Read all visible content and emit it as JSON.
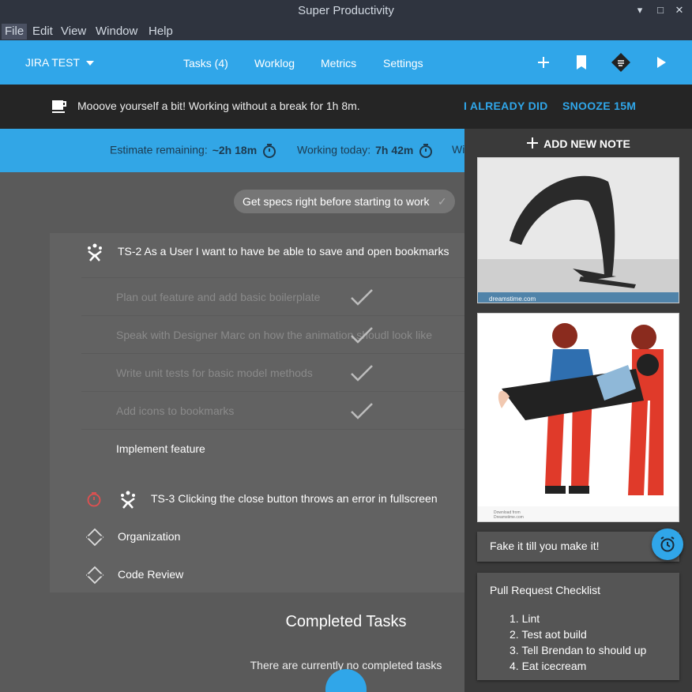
{
  "window": {
    "title": "Super Productivity",
    "minimize": "▾",
    "maximize": "□",
    "close": "✕"
  },
  "menu": [
    "File",
    "Edit",
    "View",
    "Window",
    "Help"
  ],
  "header": {
    "project": "JIRA TEST",
    "nav": [
      "Tasks (4)",
      "Worklog",
      "Metrics",
      "Settings"
    ]
  },
  "banner": {
    "message": "Mooove yourself a bit! Working without a break for 1h 8m.",
    "btn_done": "I ALREADY DID",
    "btn_snooze": "SNOOZE 15M"
  },
  "stats": {
    "estimate_label": "Estimate remaining:",
    "estimate_value": "~2h 18m",
    "working_label": "Working today:",
    "working_value": "7h 42m",
    "overflow": "Wi"
  },
  "focus_chip": "Get specs right before starting to work",
  "tasks": [
    {
      "id": "ts2",
      "label": "TS-2 As a User I want to have be able to save and open bookmarks",
      "icon": "jira-icon"
    },
    {
      "id": "ts3",
      "label": "TS-3 Clicking the close button throws an error in fullscreen",
      "icon": "jira-icon"
    },
    {
      "id": "org",
      "label": "Organization",
      "icon": "repeat-icon"
    },
    {
      "id": "review",
      "label": "Code Review",
      "icon": "repeat-icon"
    }
  ],
  "subtasks": [
    {
      "label": "Plan out feature and add basic boilerplate",
      "done": true
    },
    {
      "label": "Speak with Designer Marc on how the animation shoudl look like",
      "done": true
    },
    {
      "label": "Write unit tests for basic model methods",
      "done": true
    },
    {
      "label": "Add icons to bookmarks",
      "done": true
    },
    {
      "label": "Implement feature",
      "done": false
    }
  ],
  "completed": {
    "title": "Completed Tasks",
    "empty": "There are currently no completed tasks"
  },
  "notes": {
    "add_label": "ADD NEW NOTE",
    "image1_watermark": "dreamstime.com",
    "image2_caption": "Download from",
    "image2_caption2": "Dreamstime.com",
    "motto": "Fake it till you make it!",
    "checklist_title": "Pull Request Checklist",
    "checklist": [
      "1. Lint",
      "2. Test aot build",
      "3. Tell Brendan to should up",
      "4. Eat icecream"
    ]
  },
  "colors": {
    "accent": "#30a6e9",
    "titlebar": "#2f343f",
    "banner_bg": "#252525",
    "main_bg": "#5a5a5a"
  }
}
